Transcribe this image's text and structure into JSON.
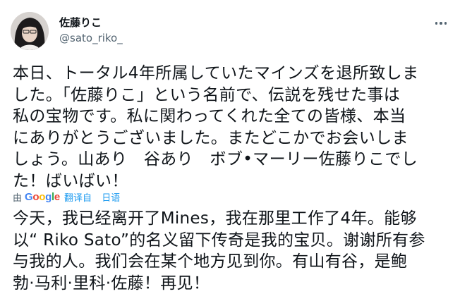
{
  "author": {
    "name": "佐藤りこ",
    "handle": "@sato_riko_"
  },
  "tweet": {
    "lines": [
      "本日、トータル4年所属していたマインズを退所致しま",
      "した。「佐藤りこ」という名前で、伝説を残せた事は",
      "私の宝物です。私に関わってくれた全ての皆様、本当",
      "にありがとうございました。またどこかでお会いしま",
      "しょう。山あり　谷あり　ボブ•マーリー佐藤りこでし",
      "た！ばいばい！"
    ]
  },
  "translation": {
    "by_label": "由",
    "provider": "Google",
    "action_label": "翻译自",
    "source_language": "日语",
    "google_colors": [
      "#4285F4",
      "#EA4335",
      "#FBBC05",
      "#4285F4",
      "#34A853",
      "#EA4335"
    ],
    "lines": [
      "今天，我已经离开了Mines，我在那里工作了4年。能够",
      "以“ Riko Sato”的名义留下传奇是我的宝贝。谢谢所有参",
      "与我的人。我们会在某个地方见到你。有山有谷，是鲍",
      "勃·马利·里科·佐藤！再见！"
    ]
  },
  "icons": {
    "more": "more-horizontal-icon",
    "avatar": "profile-avatar"
  }
}
